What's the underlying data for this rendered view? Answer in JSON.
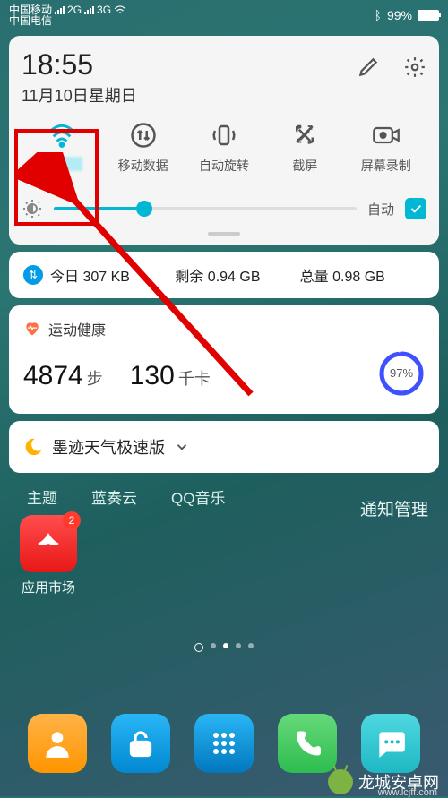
{
  "status": {
    "carrier1": "中国移动",
    "carrier2": "中国电信",
    "net1": "2G",
    "net2": "3G",
    "battery_pct": "99%"
  },
  "panel": {
    "time": "18:55",
    "date": "11月10日星期日",
    "toggles": {
      "wifi": "",
      "mobile_data": "移动数据",
      "auto_rotate": "自动旋转",
      "screenshot": "截屏",
      "screen_record": "屏幕录制"
    },
    "brightness": {
      "auto_label": "自动"
    }
  },
  "data_usage": {
    "today_label": "今日",
    "today_value": "307 KB",
    "remain_label": "剩余",
    "remain_value": "0.94 GB",
    "total_label": "总量",
    "total_value": "0.98 GB"
  },
  "health": {
    "title": "运动健康",
    "steps_value": "4874",
    "steps_unit": "步",
    "kcal_value": "130",
    "kcal_unit": "千卡",
    "ring_pct": "97%"
  },
  "weather": {
    "title": "墨迹天气极速版"
  },
  "home": {
    "icon_labels": [
      "主题",
      "蓝奏云",
      "QQ音乐"
    ],
    "notif_manage": "通知管理",
    "appmarket_label": "应用市场",
    "appmarket_badge": "2"
  },
  "watermark": {
    "text": "龙城安卓网",
    "url": "www.lcjff.com"
  }
}
